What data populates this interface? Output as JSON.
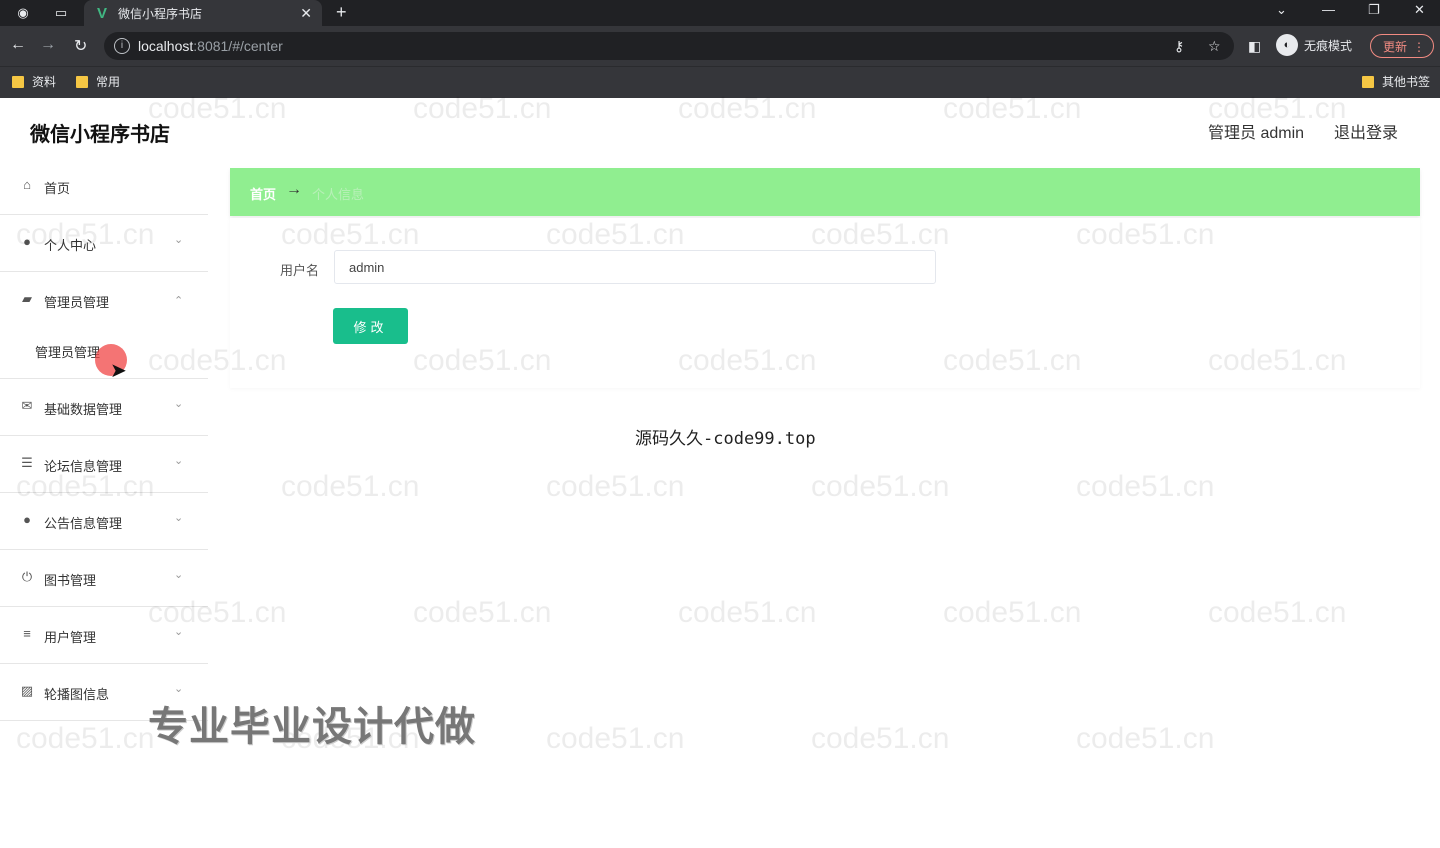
{
  "browser": {
    "tab_title": "微信小程序书店",
    "url_host": "localhost",
    "url_rest": ":8081/#/center",
    "incognito_label": "无痕模式",
    "update_label": "更新",
    "bookmarks": [
      "资料",
      "常用"
    ],
    "other_bookmarks": "其他书签"
  },
  "header": {
    "title": "微信小程序书店",
    "user": "管理员 admin",
    "logout": "退出登录"
  },
  "sidebar": {
    "items": [
      {
        "label": "首页",
        "icon": "home-icon"
      },
      {
        "label": "个人中心",
        "icon": "user-icon"
      },
      {
        "label": "管理员管理",
        "icon": "admin-icon",
        "expanded": true,
        "sub": "管理员管理"
      },
      {
        "label": "基础数据管理",
        "icon": "mail-icon"
      },
      {
        "label": "论坛信息管理",
        "icon": "list-icon"
      },
      {
        "label": "公告信息管理",
        "icon": "person-icon"
      },
      {
        "label": "图书管理",
        "icon": "power-icon"
      },
      {
        "label": "用户管理",
        "icon": "sliders-icon"
      },
      {
        "label": "轮播图信息",
        "icon": "image-icon"
      }
    ]
  },
  "breadcrumb": {
    "home": "首页",
    "separator": "→",
    "current": "个人信息"
  },
  "form": {
    "username_label": "用户名",
    "username_value": "admin",
    "submit_label": "修改"
  },
  "footer_text": "源码久久-code99.top",
  "promo_text": "专业毕业设计代做",
  "watermark": "code51.cn",
  "colors": {
    "breadcrumb_bg": "#90ee90",
    "primary_button": "#19be8c"
  }
}
